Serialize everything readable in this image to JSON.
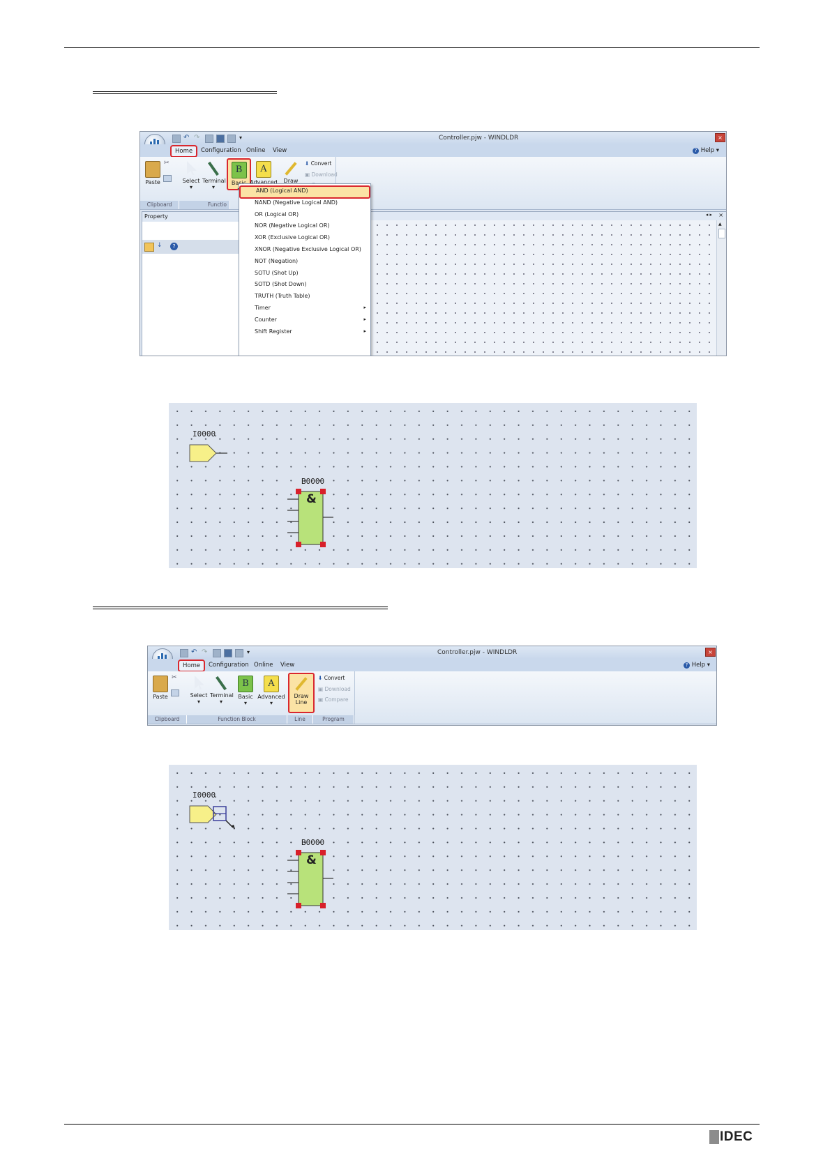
{
  "window": {
    "title": "Controller.pjw - WINDLDR",
    "close_glyph": "×",
    "help_label": "Help"
  },
  "menu": {
    "home": "Home",
    "configuration": "Configuration",
    "online": "Online",
    "view": "View"
  },
  "ribbon": {
    "paste": "Paste",
    "select": "Select",
    "terminal": "Terminal",
    "basic": "Basic",
    "advanced": "Advanced",
    "draw_line": "Draw Line",
    "convert": "Convert",
    "download": "Download",
    "compare": "Compare",
    "group_clipboard": "Clipboard",
    "group_function_truncated": "Functio",
    "group_function_block": "Function Block",
    "group_line": "Line",
    "group_program": "Program"
  },
  "property_panel": {
    "title": "Property"
  },
  "basic_menu": {
    "items": [
      {
        "label": "AND (Logical AND)",
        "submenu": false
      },
      {
        "label": "NAND (Negative Logical AND)",
        "submenu": false
      },
      {
        "label": "OR (Logical OR)",
        "submenu": false
      },
      {
        "label": "NOR (Negative Logical OR)",
        "submenu": false
      },
      {
        "label": "XOR (Exclusive Logical OR)",
        "submenu": false
      },
      {
        "label": "XNOR (Negative Exclusive Logical OR)",
        "submenu": false
      },
      {
        "label": "NOT (Negation)",
        "submenu": false
      },
      {
        "label": "SOTU (Shot Up)",
        "submenu": false
      },
      {
        "label": "SOTD (Shot Down)",
        "submenu": false
      },
      {
        "label": "TRUTH (Truth Table)",
        "submenu": false
      },
      {
        "label": "Timer",
        "submenu": true
      },
      {
        "label": "Counter",
        "submenu": true
      },
      {
        "label": "Shift Register",
        "submenu": true
      }
    ],
    "selected_index": 0
  },
  "diagram": {
    "input_label": "I0000",
    "block_label": "B0000",
    "block_symbol": "&"
  },
  "footer": {
    "brand": "IDEC"
  },
  "colors": {
    "highlight_red": "#d9272e",
    "input_fill": "#f7f089",
    "block_fill": "#b8e27a",
    "handle_red": "#d8202a",
    "canvas_bg": "#dde4ef",
    "brand_gray": "#8c8c8c"
  }
}
